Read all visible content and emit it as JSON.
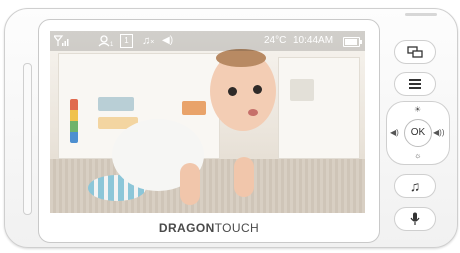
{
  "statusbar": {
    "temperature": "24°C",
    "time": "10:44AM",
    "camera_number": "1",
    "battery_level": 0.95,
    "icons": [
      "signal-icon",
      "camera-person-icon",
      "camera-number-icon",
      "music-off-icon",
      "volume-icon",
      "battery-icon"
    ]
  },
  "brand": {
    "part1": "DRAGON",
    "part2": "TOUCH"
  },
  "buttons": {
    "ok_label": "OK",
    "icons": [
      "switch-screen-icon",
      "menu-icon",
      "brightness-up-icon",
      "brightness-down-icon",
      "volume-down-icon",
      "volume-up-icon",
      "lullaby-music-icon",
      "talk-microphone-icon"
    ]
  },
  "colors": {
    "device_body": "#f5f5f5",
    "bezel_outline": "#c9c9c9",
    "statusbar_text": "#ffffff"
  }
}
